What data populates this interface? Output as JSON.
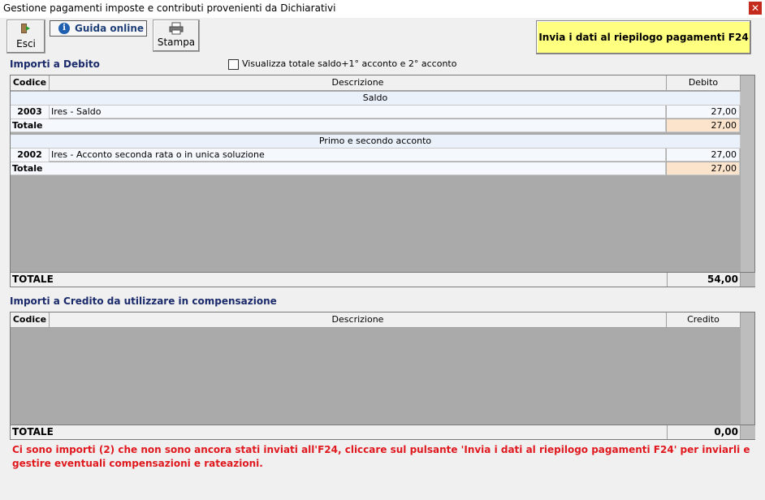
{
  "window": {
    "title": "Gestione pagamenti imposte e contributi provenienti da Dichiarativi",
    "close_label": "✕"
  },
  "toolbar": {
    "esci_label": "Esci",
    "guida_label": "Guida online",
    "stampa_label": "Stampa",
    "send_label": "Invia i dati al riepilogo pagamenti F24"
  },
  "debito": {
    "title": "Importi a Debito",
    "checkbox_label": "Visualizza totale saldo+1° acconto e 2° acconto",
    "columns": {
      "codice": "Codice",
      "descrizione": "Descrizione",
      "importo": "Debito"
    },
    "groups": [
      {
        "label": "Saldo",
        "rows": [
          {
            "code": "2003",
            "desc": "Ires - Saldo",
            "amount": "27,00"
          }
        ],
        "total_label": "Totale",
        "total": "27,00"
      },
      {
        "label": "Primo e secondo acconto",
        "rows": [
          {
            "code": "2002",
            "desc": "Ires - Acconto seconda rata o in unica soluzione",
            "amount": "27,00"
          }
        ],
        "total_label": "Totale",
        "total": "27,00"
      }
    ],
    "grand_total_label": "TOTALE",
    "grand_total": "54,00"
  },
  "credito": {
    "title": "Importi a Credito da utilizzare in compensazione",
    "columns": {
      "codice": "Codice",
      "descrizione": "Descrizione",
      "importo": "Credito"
    },
    "grand_total_label": "TOTALE",
    "grand_total": "0,00"
  },
  "warning": "Ci sono importi (2) che non sono ancora stati inviati all'F24, cliccare sul pulsante 'Invia i dati al riepilogo pagamenti F24' per inviarli e gestire eventuali compensazioni e rateazioni.",
  "icons": {
    "esci": "exit-icon",
    "guida": "info-icon",
    "stampa": "printer-icon"
  },
  "colors": {
    "send_button": "#ffff80",
    "warning": "#e0191f",
    "total_cell": "#fbe3cc",
    "section_title": "#1a2a6a"
  }
}
